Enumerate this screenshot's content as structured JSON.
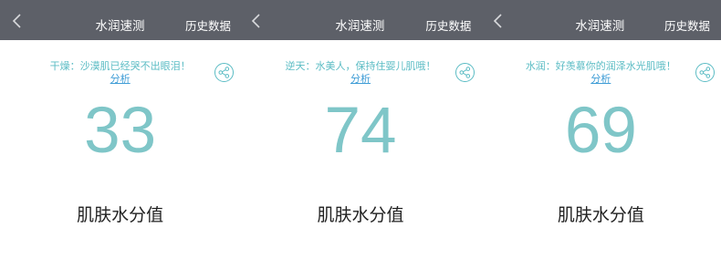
{
  "navbar": {
    "title": "水润速测",
    "history_label": "历史数据"
  },
  "score_label": "肌肤水分值",
  "analyze_label": "分析",
  "colors": {
    "navbar_bg": "#5d6068",
    "accent": "#5bbcc4",
    "score": "#7fc6c8",
    "link": "#3f9dd6"
  },
  "icons": {
    "back": "chevron-left-icon",
    "share": "share-icon"
  },
  "panels": [
    {
      "tip": "干燥：沙漠肌已经哭不出眼泪！",
      "score": 33
    },
    {
      "tip": "逆天：水美人，保持住婴儿肌哦！",
      "score": 74
    },
    {
      "tip": "水润：好羡慕你的润泽水光肌哦！",
      "score": 69
    }
  ]
}
